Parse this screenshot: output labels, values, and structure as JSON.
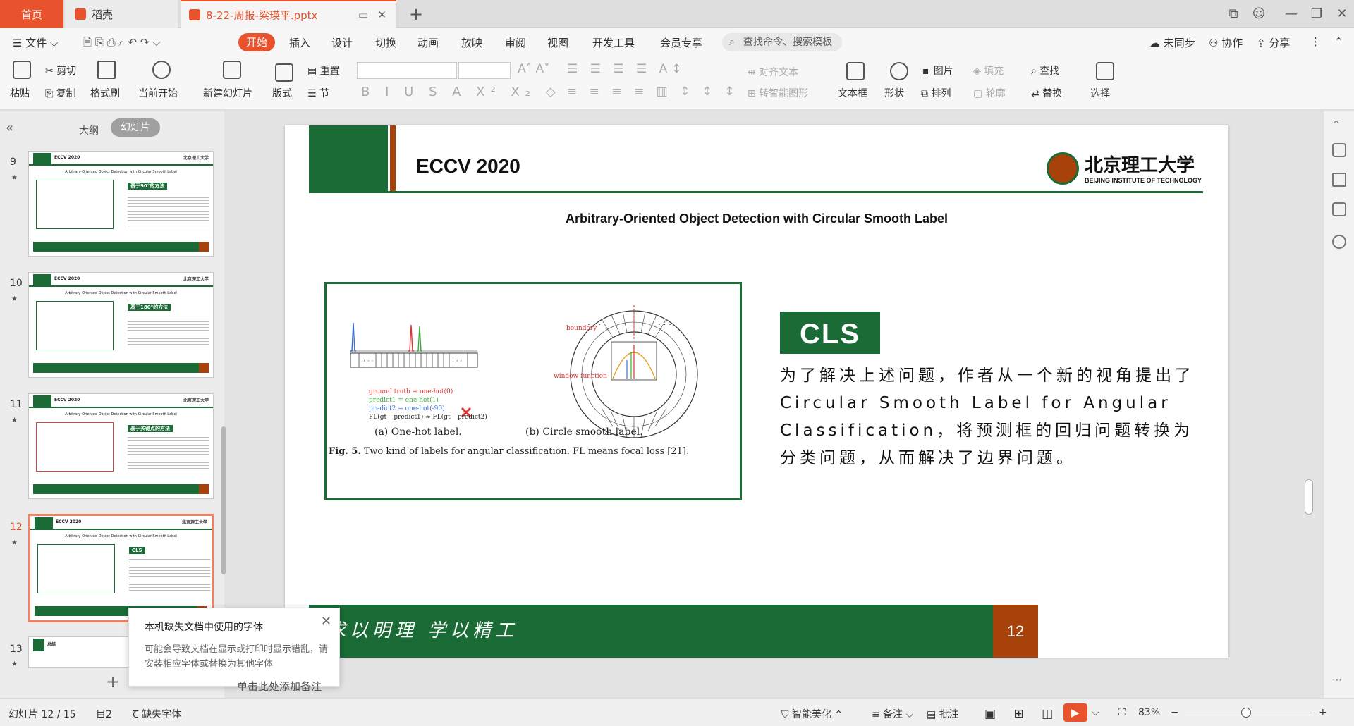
{
  "tabs": {
    "home": "首页",
    "wps": "稻壳",
    "file": "8-22-周报-梁瑛平.pptx"
  },
  "menu": {
    "file": "文件",
    "items": [
      "开始",
      "插入",
      "设计",
      "切换",
      "动画",
      "放映",
      "审阅",
      "视图",
      "开发工具",
      "会员专享"
    ],
    "search": "查找命令、搜索模板",
    "sync": "未同步",
    "collab": "协作",
    "share": "分享"
  },
  "toolbar": {
    "paste": "粘贴",
    "cut": "剪切",
    "copy": "复制",
    "format_painter": "格式刷",
    "from_current": "当前开始",
    "new_slide": "新建幻灯片",
    "layout": "版式",
    "reset": "重置",
    "section": "节",
    "align_text": "对齐文本",
    "smartart": "转智能图形",
    "textbox": "文本框",
    "shape": "形状",
    "picture": "图片",
    "arrange": "排列",
    "fill": "填充",
    "outline": "轮廓",
    "find": "查找",
    "replace": "替换",
    "select": "选择"
  },
  "panel": {
    "outline_tab": "大纲",
    "slides_tab": "幻灯片",
    "thumbs": [
      {
        "num": "9",
        "badge": "基于90°的方法"
      },
      {
        "num": "10",
        "badge": "基于180°的方法"
      },
      {
        "num": "11",
        "badge": "基于关键点的方法"
      },
      {
        "num": "12",
        "badge": "CLS"
      },
      {
        "num": "13",
        "badge": "总结"
      }
    ],
    "thumb_title": "ECCV 2020",
    "thumb_logo": "北京理工大学",
    "thumb_subtitle": "Arbitrary-Oriented Object Detection with Circular Smooth Label"
  },
  "popup": {
    "title": "本机缺失文档中使用的字体",
    "body": "可能会导致文档在显示或打印时显示错乱，请安装相应字体或替换为其他字体"
  },
  "slide": {
    "title": "ECCV 2020",
    "logo_cn": "北京理工大学",
    "logo_en": "BEIJING INSTITUTE OF TECHNOLOGY",
    "subtitle": "Arbitrary-Oriented Object Detection with Circular Smooth Label",
    "badge": "CLS",
    "body": "为了解决上述问题，作者从一个新的视角提出了Circular Smooth Label for Angular Classification，将预测框的回归问题转换为分类问题，从而解决了边界问题。",
    "motto": "求以明理  学以精工",
    "page_num": "12",
    "figure": {
      "gt": "ground truth = one-hot(0)",
      "p1": "predict1 = one-hot(1)",
      "p2": "predict2 = one-hot(-90)",
      "fl": "FL(gt – predict1) ≈ FL(gt – predict2)",
      "boundary": "boundary",
      "window": "window function",
      "cap_a": "(a) One-hot label.",
      "cap_b": "(b) Circle smooth label.",
      "caption_bold": "Fig. 5.",
      "caption": " Two kind of labels for angular classification. FL means focal loss [21]."
    }
  },
  "notes_hint": "单击此处添加备注",
  "status": {
    "slide_pos": "幻灯片 12 / 15",
    "theme": "目2",
    "missing_font": "缺失字体",
    "beautify": "智能美化",
    "notes": "备注",
    "comments": "批注",
    "zoom": "83%"
  }
}
